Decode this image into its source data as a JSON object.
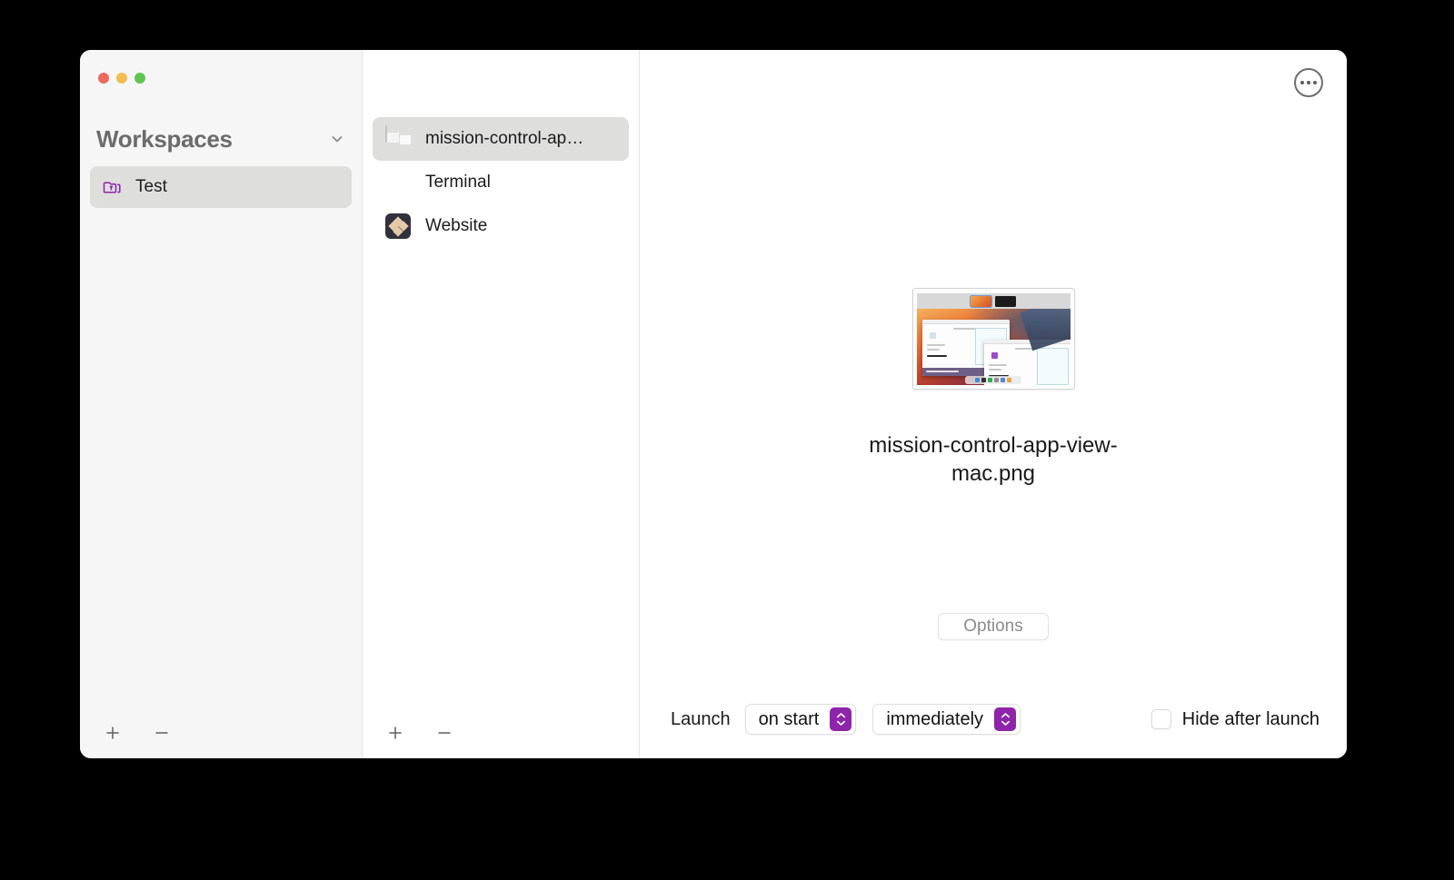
{
  "window": {
    "traffic_lights": {
      "close_color": "#ec6a5e",
      "minimize_color": "#f4bd4f",
      "maximize_color": "#61c554"
    }
  },
  "sidebar": {
    "title": "Workspaces",
    "collapse_icon": "chevron-down-icon",
    "items": [
      {
        "label": "Test",
        "icon": "folder-stack-icon",
        "icon_color": "#8d23a8",
        "selected": true
      }
    ],
    "footer": {
      "add_label": "+",
      "remove_label": "−"
    }
  },
  "app_list": {
    "items": [
      {
        "label": "mission-control-ap…",
        "icon": "screenshot-thumbnail-icon",
        "selected": true
      },
      {
        "label": "Terminal",
        "icon": "missing-app-circle-x-icon",
        "selected": false
      },
      {
        "label": "Website",
        "icon": "website-diamond-icon",
        "selected": false
      }
    ],
    "footer": {
      "add_label": "+",
      "remove_label": "−"
    }
  },
  "detail": {
    "more_icon": "ellipsis-circle-icon",
    "preview": {
      "icon": "mission-control-screenshot-preview",
      "filename": "mission-control-app-view-mac.png"
    },
    "options_label": "Options",
    "launch": {
      "label": "Launch",
      "when_value": "on start",
      "when_options": [
        "on start"
      ],
      "delay_value": "immediately",
      "delay_options": [
        "immediately"
      ],
      "stepper_color": "#8e24aa",
      "hide_after_launch_label": "Hide after launch",
      "hide_after_launch_checked": false
    }
  }
}
